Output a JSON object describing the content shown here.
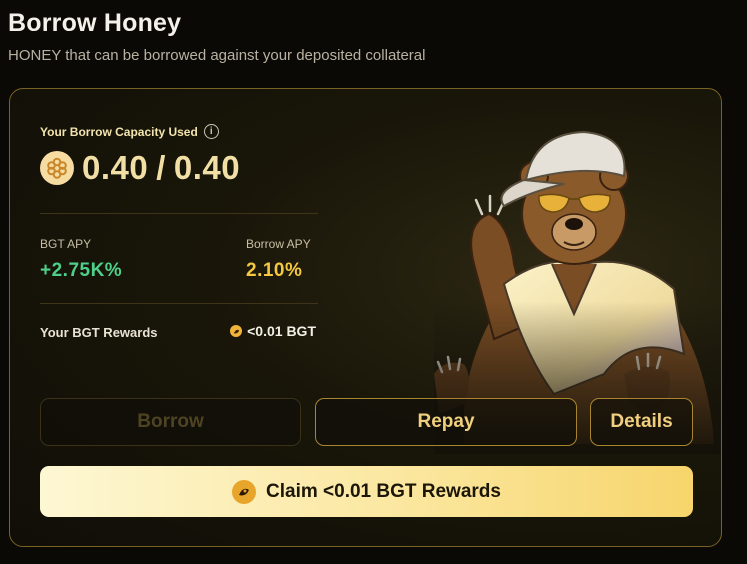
{
  "header": {
    "title": "Borrow Honey",
    "subtitle": "HONEY that can be borrowed against your deposited collateral"
  },
  "capacity": {
    "label": "Your Borrow Capacity Used",
    "used": "0.40",
    "separator": "/",
    "total": "0.40"
  },
  "stats": {
    "bgt_apy_label": "BGT APY",
    "bgt_apy_value": "+2.75K%",
    "borrow_apy_label": "Borrow APY",
    "borrow_apy_value": "2.10%"
  },
  "rewards": {
    "label": "Your BGT Rewards",
    "value": "<0.01 BGT"
  },
  "buttons": {
    "borrow": "Borrow",
    "repay": "Repay",
    "details": "Details",
    "claim": "Claim <0.01 BGT Rewards"
  },
  "icons": {
    "info": "info-icon",
    "honey": "honey-token-icon",
    "bgt": "bgt-token-icon",
    "illustration": "bear-illustration"
  },
  "colors": {
    "accent": "#f0cf7e",
    "positive": "#4fd08a",
    "borrow_apy": "#f5c842",
    "card_border": "#7a6224"
  }
}
